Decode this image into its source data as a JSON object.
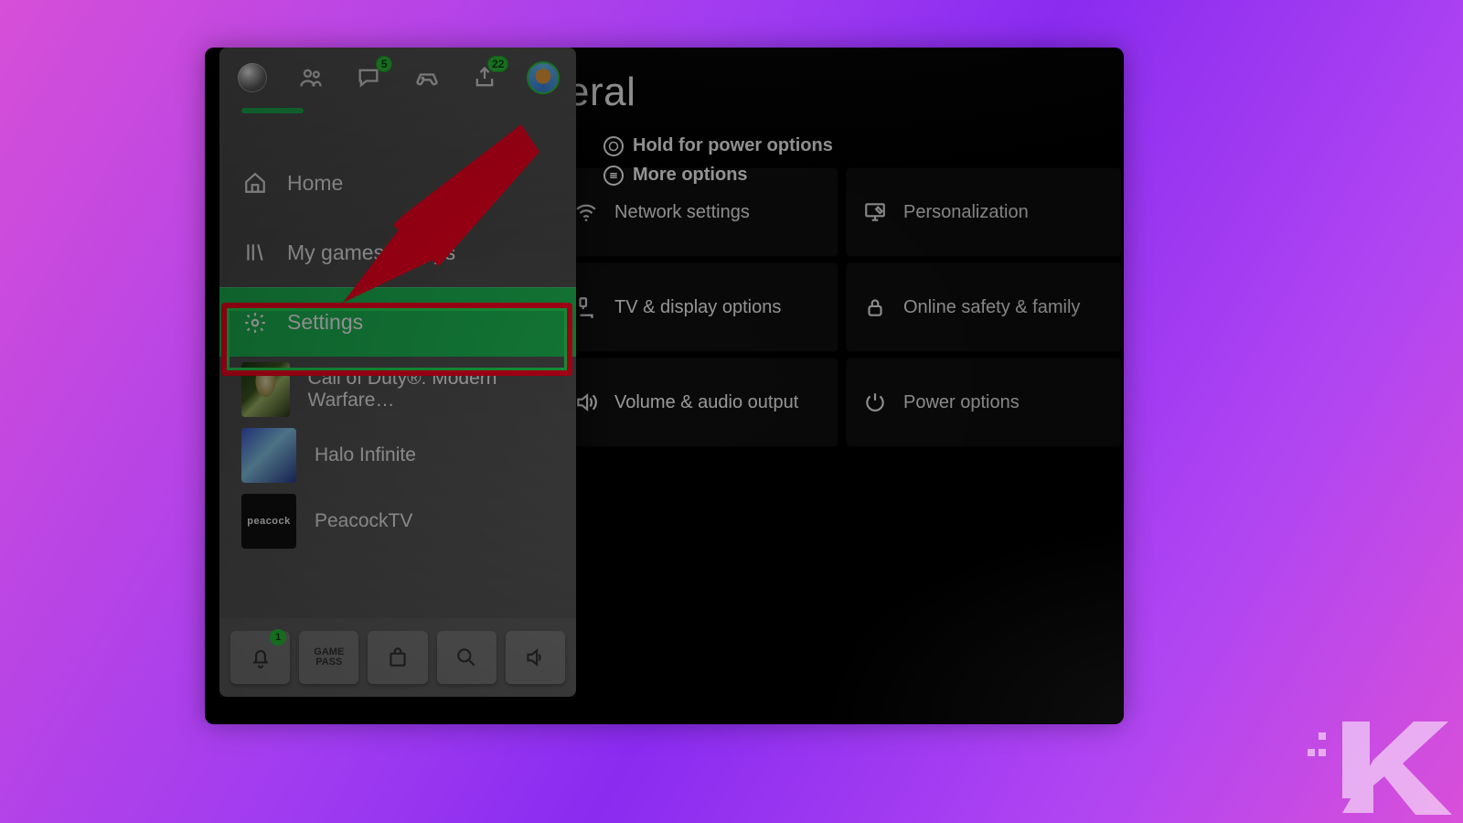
{
  "page": {
    "title_visible": "eral",
    "full_title": "General"
  },
  "hints": {
    "power": "Hold for power options",
    "more": "More options"
  },
  "tiles": [
    [
      {
        "id": "network",
        "label": "Network settings",
        "icon": "wifi"
      },
      {
        "id": "personalization",
        "label": "Personalization",
        "icon": "monitor-edit"
      }
    ],
    [
      {
        "id": "tvdisplay",
        "label": "TV & display options",
        "icon": "tv-cable"
      },
      {
        "id": "safety",
        "label": "Online safety & family",
        "icon": "lock"
      }
    ],
    [
      {
        "id": "audio",
        "label": "Volume & audio output",
        "icon": "speaker"
      },
      {
        "id": "power",
        "label": "Power options",
        "icon": "power-recycle"
      }
    ]
  ],
  "guide": {
    "tabs": [
      {
        "id": "xbox",
        "icon": "xbox-orb",
        "badge": null,
        "active": true
      },
      {
        "id": "friends",
        "icon": "friends",
        "badge": null
      },
      {
        "id": "chat",
        "icon": "chat",
        "badge": "5"
      },
      {
        "id": "games",
        "icon": "controller",
        "badge": null
      },
      {
        "id": "share",
        "icon": "share",
        "badge": "22"
      },
      {
        "id": "profile",
        "icon": "avatar",
        "badge": null
      }
    ],
    "nav": [
      {
        "id": "home",
        "label": "Home",
        "icon": "home"
      },
      {
        "id": "library",
        "label": "My games & apps",
        "icon": "library"
      },
      {
        "id": "settings",
        "label": "Settings",
        "icon": "gear",
        "selected": true
      }
    ],
    "recent": [
      {
        "id": "mw2",
        "label": "Call of Duty®: Modern Warfare…",
        "thumbClass": "mw"
      },
      {
        "id": "halo",
        "label": "Halo Infinite",
        "thumbClass": "halo"
      },
      {
        "id": "peacock",
        "label": "PeacockTV",
        "thumbClass": "peacock",
        "thumbText": "peacock"
      }
    ],
    "footer": [
      {
        "id": "notifications",
        "icon": "bell",
        "badge": "1"
      },
      {
        "id": "gamepass",
        "icon": "text",
        "text": "GAME\nPASS"
      },
      {
        "id": "store",
        "icon": "store"
      },
      {
        "id": "search",
        "icon": "search"
      },
      {
        "id": "audiosettings",
        "icon": "speaker"
      }
    ]
  },
  "watermark": "K",
  "colors": {
    "accent": "#1db954",
    "badge": "#2bd13a",
    "highlight": "#ff0020"
  }
}
